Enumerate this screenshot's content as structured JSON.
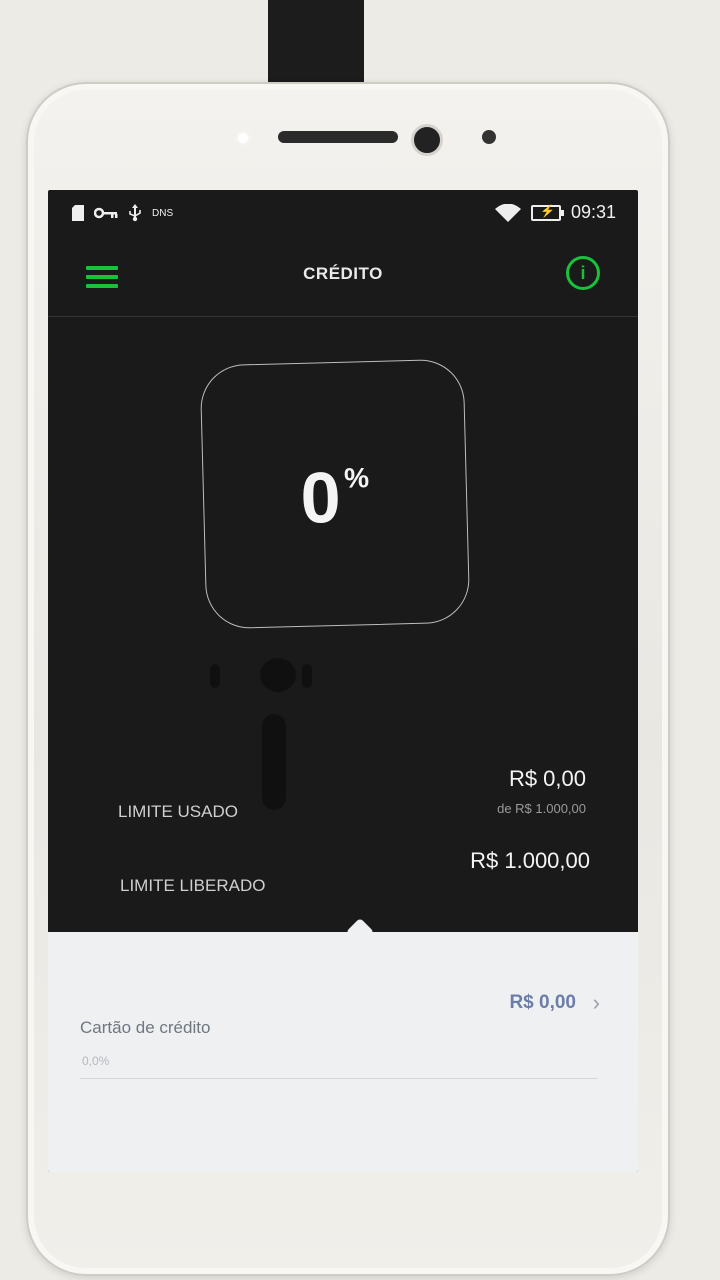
{
  "status_bar": {
    "notification_icons": [
      "sim-icon",
      "key-icon",
      "usb-icon"
    ],
    "dns_label": "DNS",
    "time": "09:31"
  },
  "app_bar": {
    "title": "CRÉDITO",
    "menu_icon": "hamburger-icon",
    "info_icon": "info-icon",
    "info_glyph": "i",
    "accent_color": "#19c23b"
  },
  "gauge": {
    "percent_value": "0",
    "percent_sign": "%"
  },
  "limits": {
    "used_label": "LIMITE USADO",
    "used_value": "R$ 0,00",
    "used_of": "de R$ 1.000,00",
    "released_label": "LIMITE LIBERADO",
    "released_value": "R$ 1.000,00"
  },
  "panel": {
    "card_label": "Cartão de crédito",
    "card_value": "R$ 0,00",
    "card_sub": "0,0%",
    "chevron": "›"
  },
  "colors": {
    "screen_bg": "#1a1a1a",
    "panel_bg": "#eef0f2",
    "card_value": "#6c7ea8"
  }
}
